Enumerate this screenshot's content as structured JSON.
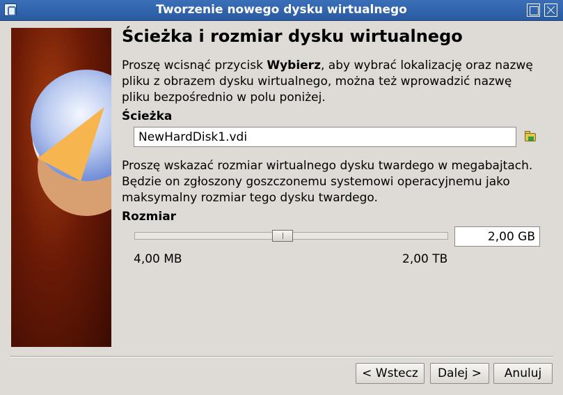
{
  "window": {
    "title": "Tworzenie nowego dysku wirtualnego"
  },
  "heading": "Ścieżka i rozmiar dysku wirtualnego",
  "intro": {
    "before": "Proszę wcisnąć przycisk ",
    "bold": "Wybierz",
    "after": ", aby wybrać lokalizację oraz nazwę pliku z obrazem dysku wirtualnego, można też wprowadzić nazwę pliku bezpośrednio w polu poniżej."
  },
  "path": {
    "label": "Ścieżka",
    "value": "NewHardDisk1.vdi"
  },
  "size_text": "Proszę wskazać rozmiar wirtualnego dysku twardego w megabajtach. Będzie on zgłoszony goszczonemu systemowi operacyjnemu jako maksymalny rozmiar tego dysku twardego.",
  "size": {
    "label": "Rozmiar",
    "value": "2,00 GB",
    "min_label": "4,00 MB",
    "max_label": "2,00 TB"
  },
  "buttons": {
    "back": "< Wstecz",
    "next": "Dalej >",
    "cancel": "Anuluj"
  },
  "icons": {
    "app": "virtualbox-icon",
    "maximize": "maximize-icon",
    "close": "close-icon",
    "folder": "folder-open-icon"
  }
}
